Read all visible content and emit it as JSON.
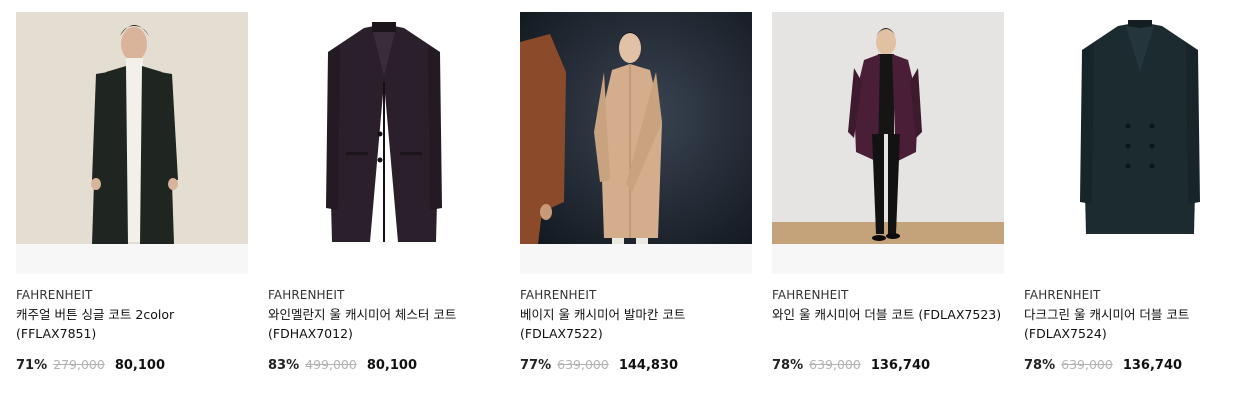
{
  "products": [
    {
      "brand": "FAHRENHEIT",
      "name": "캐주얼 버튼 싱글 코트 2color (FFLAX7851)",
      "discount": "71%",
      "original_price": "279,000",
      "sale_price": "80,100",
      "image_icon": "model-black-single-coat-image",
      "coat_color": "#1f2621",
      "bg_color": "#e4ddd2"
    },
    {
      "brand": "FAHRENHEIT",
      "name": "와인멜란지 울 캐시미어 체스터 코트 (FDHAX7012)",
      "discount": "83%",
      "original_price": "499,000",
      "sale_price": "80,100",
      "image_icon": "wine-chester-coat-image",
      "coat_color": "#2a1f2a",
      "bg_color": "#ffffff"
    },
    {
      "brand": "FAHRENHEIT",
      "name": "베이지 울 캐시미어 발마칸 코트 (FDLAX7522)",
      "discount": "77%",
      "original_price": "639,000",
      "sale_price": "144,830",
      "image_icon": "model-beige-balmacaan-coat-image",
      "coat_color": "#d4ae8c",
      "bg_color": "#1e242c"
    },
    {
      "brand": "FAHRENHEIT",
      "name": "와인 울 캐시미어 더블 코트 (FDLAX7523)",
      "discount": "78%",
      "original_price": "639,000",
      "sale_price": "136,740",
      "image_icon": "model-wine-double-coat-image",
      "coat_color": "#4a1e36",
      "bg_color": "#e6e4e2"
    },
    {
      "brand": "FAHRENHEIT",
      "name": "다크그린 울 캐시미어 더블 코트 (FDLAX7524)",
      "discount": "78%",
      "original_price": "639,000",
      "sale_price": "136,740",
      "image_icon": "dark-green-double-coat-image",
      "coat_color": "#1c2b30",
      "bg_color": "#ffffff"
    }
  ]
}
